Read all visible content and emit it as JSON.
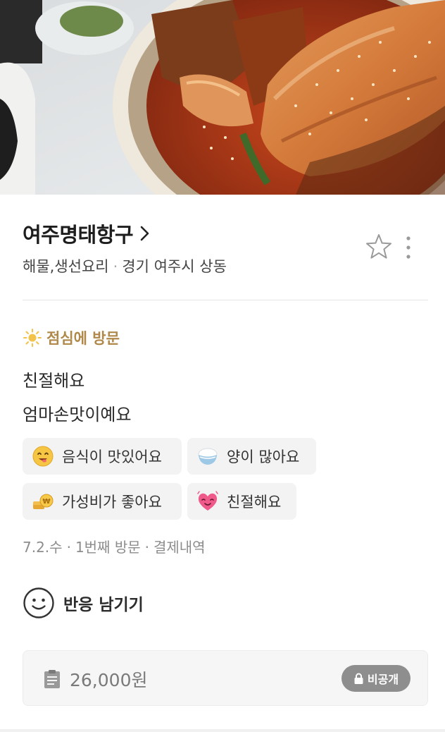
{
  "restaurant": {
    "name": "여주명태항구",
    "category": "해물,생선요리",
    "location": "경기 여주시 상동"
  },
  "visit": {
    "time_label": "점심에 방문",
    "comments": [
      "친절해요",
      "엄마손맛이예요"
    ]
  },
  "keywords": [
    {
      "label": "음식이 맛있어요",
      "icon": "yum-face-icon"
    },
    {
      "label": "양이 많아요",
      "icon": "rice-bowl-icon"
    },
    {
      "label": "가성비가 좋아요",
      "icon": "coins-icon"
    },
    {
      "label": "친절해요",
      "icon": "heart-face-icon"
    }
  ],
  "meta": {
    "date": "7.2.수",
    "visit_count": "1번째 방문",
    "payment": "결제내역"
  },
  "reaction": {
    "label": "반응 남기기"
  },
  "receipt": {
    "amount": "26,000원",
    "privacy": "비공개"
  },
  "colors": {
    "visit_label": "#b0894a",
    "chip_bg": "#f3f3f4",
    "badge_bg": "#8e8e8e"
  }
}
